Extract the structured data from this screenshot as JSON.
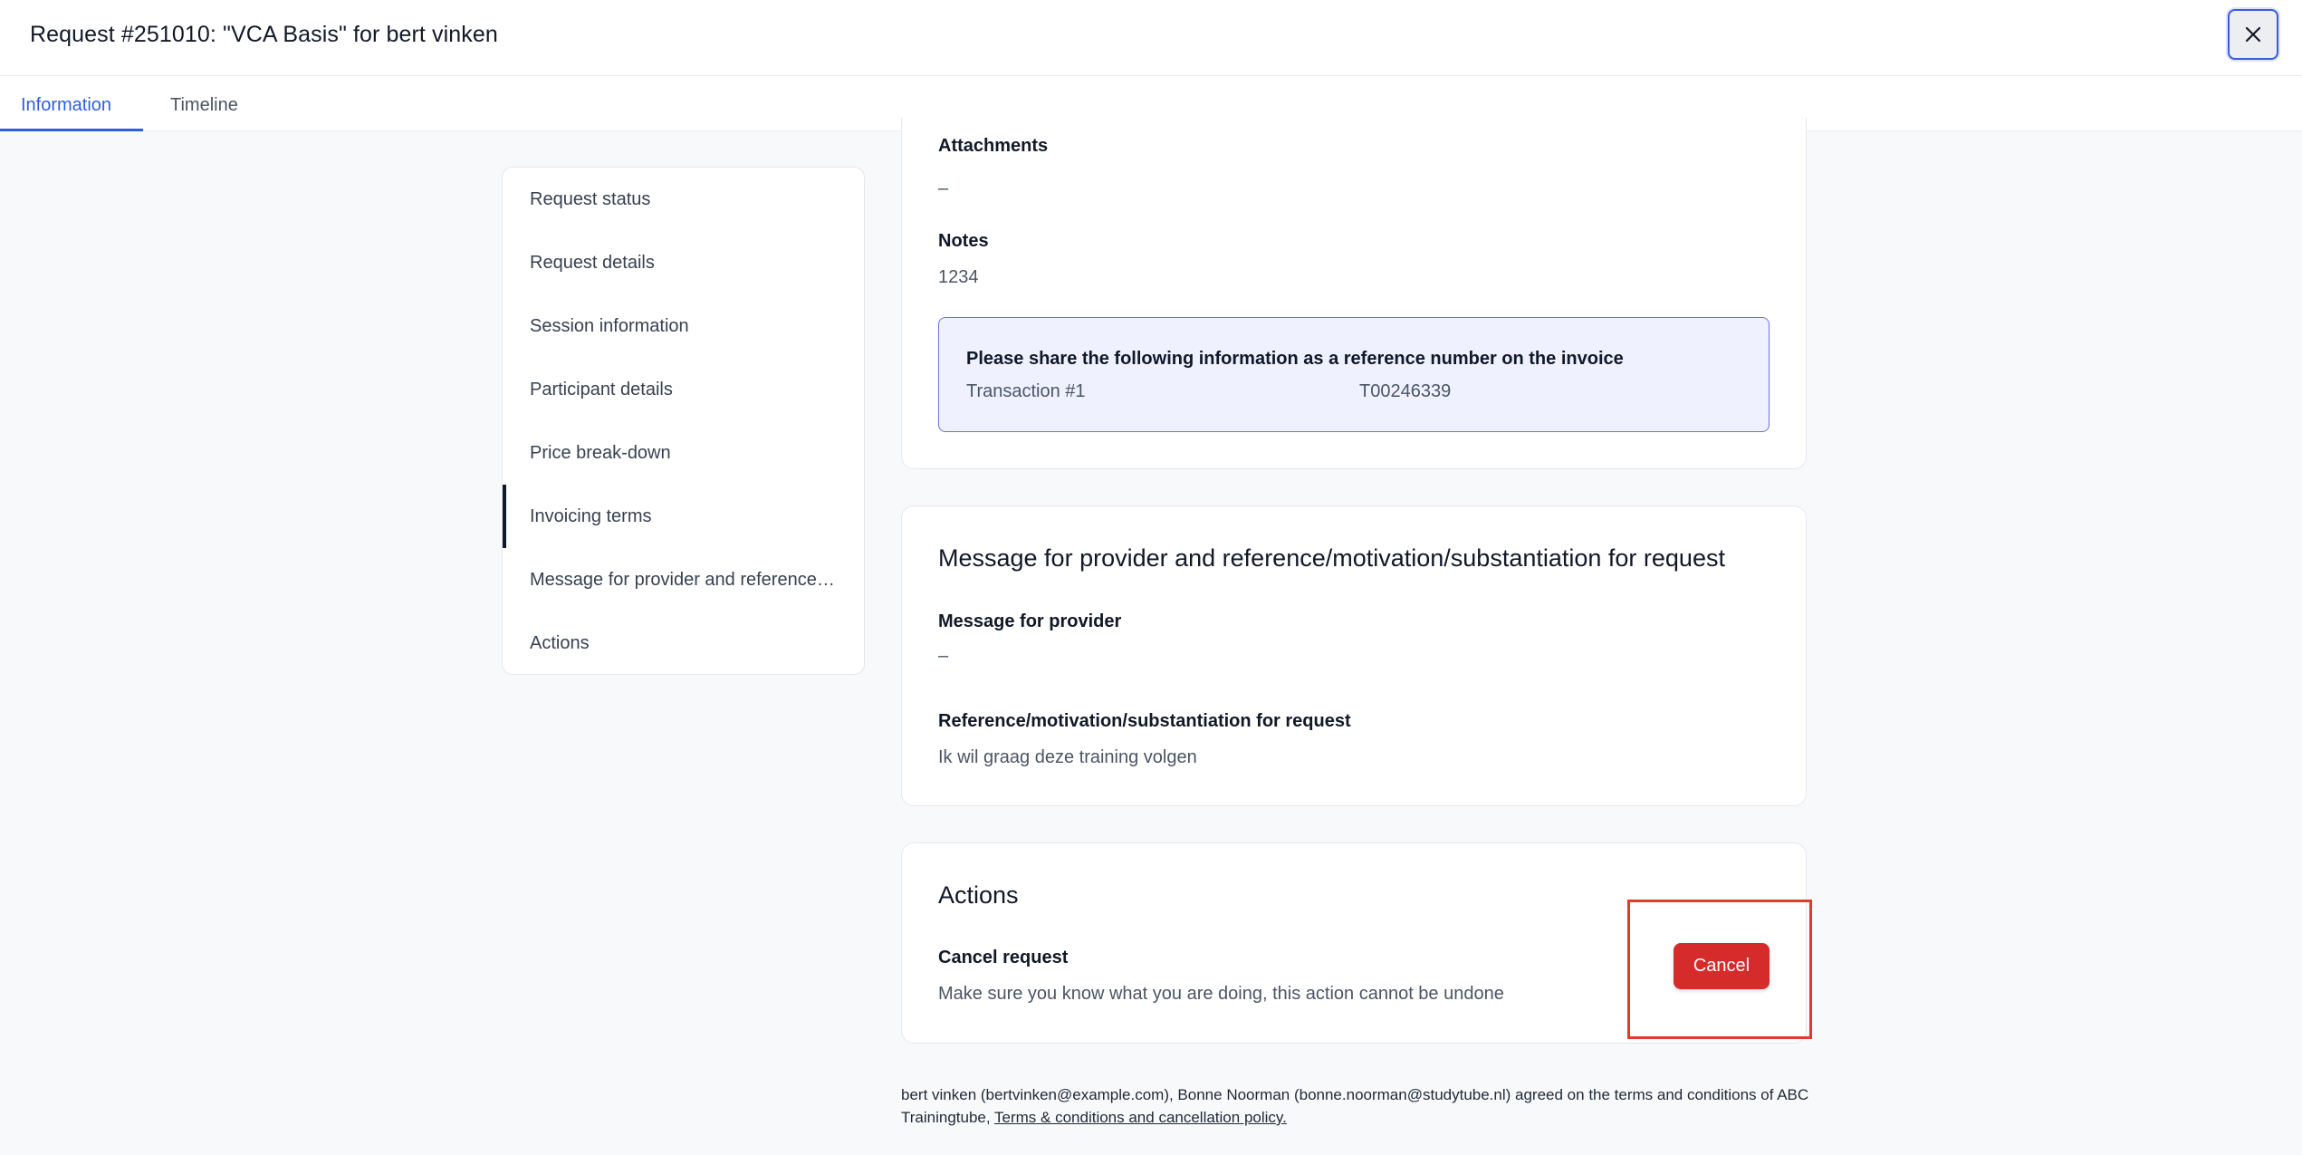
{
  "header": {
    "title": "Request #251010: \"VCA Basis\" for bert vinken"
  },
  "tabs": [
    {
      "label": "Information"
    },
    {
      "label": "Timeline"
    }
  ],
  "sidenav": {
    "items": [
      {
        "label": "Request status"
      },
      {
        "label": "Request details"
      },
      {
        "label": "Session information"
      },
      {
        "label": "Participant details"
      },
      {
        "label": "Price break-down"
      },
      {
        "label": "Invoicing terms"
      },
      {
        "label": "Message for provider and reference/motivation/substantiation for request"
      },
      {
        "label": "Actions"
      }
    ],
    "active": "Invoicing terms"
  },
  "invoicing": {
    "attachments_label": "Attachments",
    "attachments_value": "–",
    "notes_label": "Notes",
    "notes_value": "1234",
    "reference_title": "Please share the following information as a reference number on the invoice",
    "reference_key": "Transaction #1",
    "reference_value": "T00246339"
  },
  "message": {
    "title": "Message for provider and reference/motivation/substantiation for request",
    "provider_label": "Message for provider",
    "provider_value": "–",
    "reference_label": "Reference/motivation/substantiation for request",
    "reference_value": "Ik wil graag deze training volgen"
  },
  "actions": {
    "title": "Actions",
    "cancel_label": "Cancel request",
    "cancel_desc": "Make sure you know what you are doing, this action cannot be undone",
    "cancel_button": "Cancel"
  },
  "footer": {
    "agreement_text": "bert vinken (bertvinken@example.com), Bonne Noorman (bonne.noorman@studytube.nl) agreed on the terms and conditions of ABC Trainingtube, ",
    "link_text": "Terms & conditions and cancellation policy."
  },
  "colors": {
    "accent": "#2f5fe0",
    "danger": "#d62b2b",
    "highlight": "#e53a2a",
    "reference_box_bg": "#eff1ff"
  }
}
